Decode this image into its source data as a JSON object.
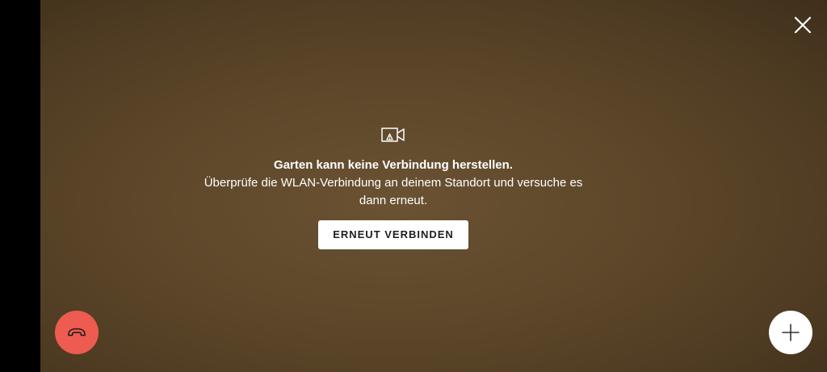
{
  "error": {
    "icon": "camera-warning-icon",
    "title": "Garten kann keine Verbindung herstellen.",
    "message": "Überprüfe die WLAN-Verbindung an deinem Standort und versuche es dann erneut.",
    "retry_label": "ERNEUT VERBINDEN"
  },
  "controls": {
    "close_icon": "close-icon",
    "hangup_icon": "hang-up-icon",
    "add_icon": "plus-icon"
  },
  "colors": {
    "hangup": "#ee5b50",
    "background": "#5c4629",
    "button": "#ffffff"
  }
}
